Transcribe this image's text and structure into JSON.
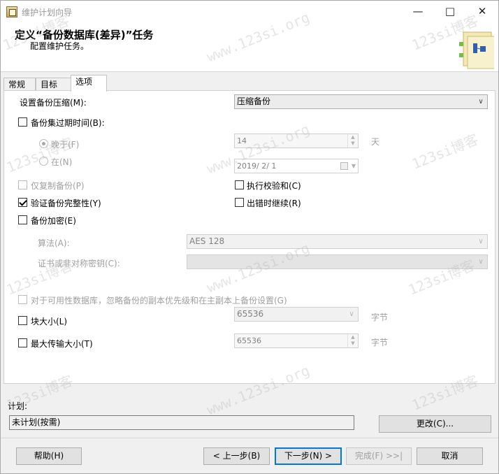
{
  "window": {
    "title": "维护计划向导",
    "header_title": "定义“备份数据库(差异)”任务",
    "header_subtitle": "配置维护任务。"
  },
  "tabs": [
    {
      "label": "常规",
      "active": false
    },
    {
      "label": "目标",
      "active": false
    },
    {
      "label": "选项",
      "active": true
    }
  ],
  "options": {
    "compression_label": "设置备份压缩(M):",
    "compression_value": "压缩备份",
    "expire_label": "备份集过期时间(B):",
    "expire_checked": false,
    "after_label": "晚于(F)",
    "after_selected": true,
    "after_value": "14",
    "after_unit": "天",
    "on_label": "在(N)",
    "on_selected": false,
    "on_value": "2019/ 2/ 1",
    "copy_only_label": "仅复制备份(P)",
    "checksum_label": "执行校验和(C)",
    "verify_label": "验证备份完整性(Y)",
    "verify_checked": true,
    "continue_label": "出错时继续(R)",
    "encrypt_label": "备份加密(E)",
    "algorithm_label": "算法(A):",
    "algorithm_value": "AES 128",
    "cert_label": "证书或非对称密钥(C):",
    "cert_value": "",
    "ag_label": "对于可用性数据库，忽略备份的副本优先级和在主副本上备份设置(G)",
    "block_size_label": "块大小(L)",
    "block_size_value": "65536",
    "block_size_unit": "字节",
    "max_transfer_label": "最大传输大小(T)",
    "max_transfer_value": "65536",
    "max_transfer_unit": "字节"
  },
  "schedule": {
    "label": "计划:",
    "value": "未计划(按需)",
    "change_button": "更改(C)..."
  },
  "footer": {
    "help": "帮助(H)",
    "back": "< 上一步(B)",
    "next": "下一步(N) >",
    "finish": "完成(F) >>|",
    "cancel": "取消"
  },
  "watermark": {
    "text1": "123si博客",
    "text2": "www.123si.org"
  }
}
